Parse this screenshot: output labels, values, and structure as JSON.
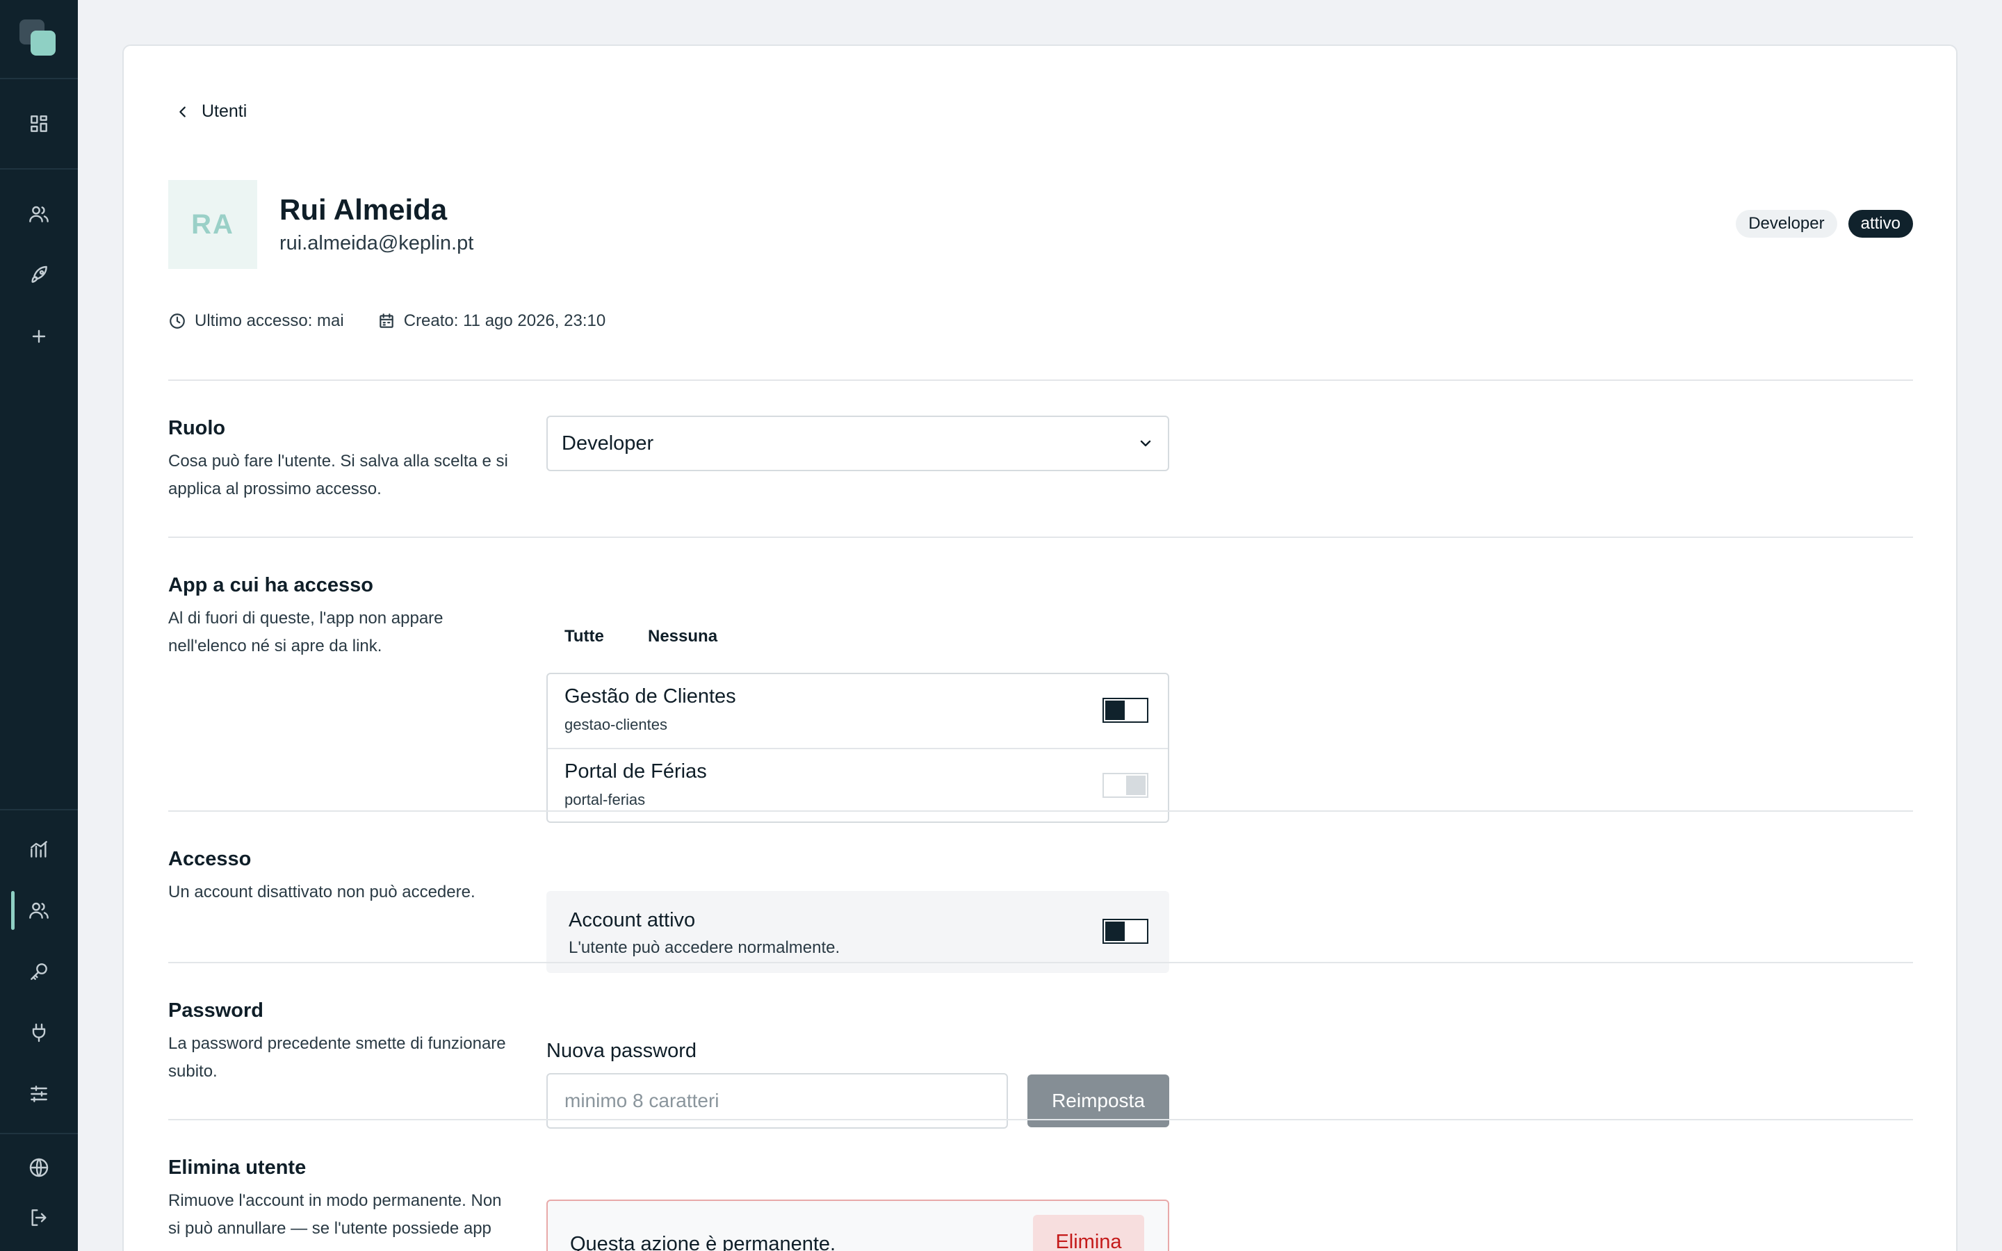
{
  "sidebar": {
    "top_items": [
      {
        "name": "dashboard-icon",
        "label": ""
      },
      {
        "name": "users-icon",
        "label": ""
      },
      {
        "name": "rocket-icon",
        "label": ""
      },
      {
        "name": "plus-icon",
        "label": ""
      }
    ],
    "bottom_items": [
      {
        "name": "analytics-icon"
      },
      {
        "name": "users-icon",
        "active": true
      },
      {
        "name": "key-icon"
      },
      {
        "name": "plug-icon"
      },
      {
        "name": "sliders-icon"
      },
      {
        "name": "globe-icon"
      },
      {
        "name": "logout-icon"
      }
    ],
    "accent_color": "#8fd0c4"
  },
  "breadcrumb": {
    "label": "Utenti"
  },
  "user": {
    "initials": "RA",
    "name": "Rui Almeida",
    "email": "rui.almeida@keplin.pt",
    "role_badge": "Developer",
    "status_badge": "attivo",
    "last_access": "Ultimo accesso: mai",
    "created": "Creato: 11 ago 2026, 23:10"
  },
  "sections": {
    "role": {
      "title": "Ruolo",
      "description": "Cosa può fare l'utente. Si salva alla scelta e si applica al prossimo accesso.",
      "selected": "Developer"
    },
    "apps": {
      "title": "App a cui ha accesso",
      "description": "Al di fuori di queste, l'app non appare nell'elenco né si apre da link.",
      "select_all": "Tutte",
      "select_none": "Nessuna",
      "items": [
        {
          "name": "Gestão de Clientes",
          "slug": "gestao-clientes",
          "enabled": true
        },
        {
          "name": "Portal de Férias",
          "slug": "portal-ferias",
          "enabled": false
        }
      ]
    },
    "access": {
      "title": "Accesso",
      "description": "Un account disattivato non può accedere.",
      "toggle_title": "Account attivo",
      "toggle_desc": "L'utente può accedere normalmente.",
      "enabled": true
    },
    "password": {
      "title": "Password",
      "description": "La password precedente smette di funzionare subito.",
      "field_label": "Nuova password",
      "placeholder": "minimo 8 caratteri",
      "button": "Reimposta"
    },
    "delete": {
      "title": "Elimina utente",
      "description": "Rimuove l'account in modo permanente. Non si può annullare — se l'utente possiede app",
      "warning": "Questa azione è permanente.",
      "button": "Elimina"
    }
  }
}
